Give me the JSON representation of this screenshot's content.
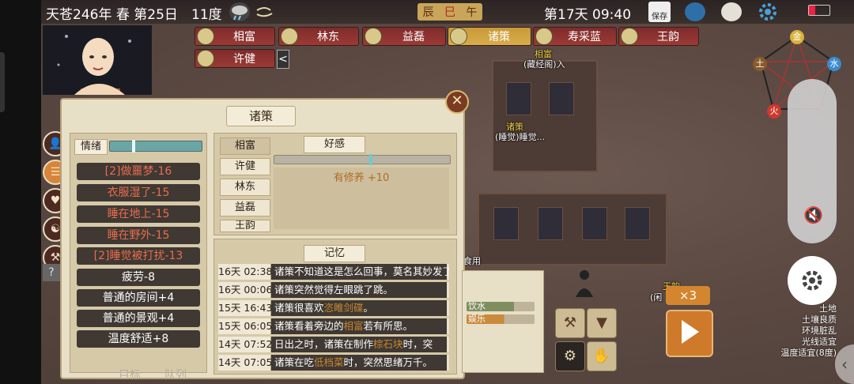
{
  "topbar": {
    "date": "天苍246年 春 第25日",
    "temperature": "11度",
    "shichen": [
      "辰",
      "巳",
      "午"
    ],
    "clock": "第17天 09:40",
    "save_label": "保存"
  },
  "character_tabs": {
    "row1": [
      {
        "name": "相富",
        "selected": false
      },
      {
        "name": "林东",
        "selected": false
      },
      {
        "name": "益磊",
        "selected": false
      },
      {
        "name": "诸策",
        "selected": true
      },
      {
        "name": "寿采蓝",
        "selected": false
      },
      {
        "name": "王韵",
        "selected": false
      }
    ],
    "row2": [
      {
        "name": "许健",
        "selected": false
      }
    ],
    "collapse_glyph": "<"
  },
  "panel": {
    "title": "诸策",
    "close_glyph": "✕",
    "mood": {
      "label": "情绪",
      "level": 0.25,
      "items": [
        {
          "text": "[2]做噩梦-16",
          "type": "neg"
        },
        {
          "text": "衣服湿了-15",
          "type": "neg"
        },
        {
          "text": "睡在地上-15",
          "type": "neg"
        },
        {
          "text": "睡在野外-15",
          "type": "neg"
        },
        {
          "text": "[2]睡觉被打扰-13",
          "type": "neg"
        },
        {
          "text": "疲劳-8",
          "type": "pos"
        },
        {
          "text": "普通的房间+4",
          "type": "pos"
        },
        {
          "text": "普通的景观+4",
          "type": "pos"
        },
        {
          "text": "温度舒适+8",
          "type": "pos"
        }
      ]
    },
    "relations": {
      "label": "好感",
      "names": [
        "相富",
        "许健",
        "林东",
        "益磊",
        "王韵"
      ],
      "selected": "相富",
      "level": 0.55,
      "detail_line": "有修养 +10"
    },
    "memory": {
      "label": "记忆",
      "rows": [
        {
          "time": "16天 02:38",
          "parts": [
            {
              "t": "诸策",
              "hl": false,
              "w": true
            },
            {
              "t": "不知道这是怎么回事，莫名其妙发了",
              "hl": false
            }
          ]
        },
        {
          "time": "16天 00:06",
          "parts": [
            {
              "t": "诸策",
              "hl": false,
              "w": true
            },
            {
              "t": "突然觉得左眼跳了跳。",
              "hl": false
            }
          ]
        },
        {
          "time": "15天 16:43",
          "parts": [
            {
              "t": "诸策",
              "hl": false,
              "w": true
            },
            {
              "t": "很喜欢",
              "hl": false
            },
            {
              "t": "恣睢剑碟",
              "hl": true
            },
            {
              "t": "。",
              "hl": false
            }
          ]
        },
        {
          "time": "15天 06:05",
          "parts": [
            {
              "t": "诸策",
              "hl": false,
              "w": true
            },
            {
              "t": "看着旁边的",
              "hl": false
            },
            {
              "t": "相富",
              "hl": true
            },
            {
              "t": "若有所思。",
              "hl": false
            }
          ]
        },
        {
          "time": "14天 07:52",
          "parts": [
            {
              "t": "日出之时，",
              "hl": false
            },
            {
              "t": "诸策",
              "hl": false,
              "w": true
            },
            {
              "t": "在制作",
              "hl": false
            },
            {
              "t": "棕石块",
              "hl": true
            },
            {
              "t": "时，突",
              "hl": false
            }
          ]
        },
        {
          "time": "14天 07:05",
          "parts": [
            {
              "t": "诸策",
              "hl": false,
              "w": true
            },
            {
              "t": "在吃",
              "hl": false
            },
            {
              "t": "低档菜",
              "hl": true
            },
            {
              "t": "时，突然思绪万千。",
              "hl": false
            }
          ]
        }
      ]
    },
    "bottom_tabs": [
      "目标",
      "队列"
    ]
  },
  "map": {
    "labels": [
      {
        "text": "相富",
        "color": "yellow"
      },
      {
        "text": "(藏经阁)入",
        "color": "white"
      },
      {
        "text": "诸策",
        "color": "yellow"
      },
      {
        "text": "(睡觉)睡觉...",
        "color": "white"
      },
      {
        "text": "食用",
        "color": "white"
      },
      {
        "text": "王韵",
        "color": "yellow"
      },
      {
        "text": "(闲",
        "color": "white"
      }
    ]
  },
  "needs_panel": {
    "items": [
      {
        "label": "饮水",
        "level": 0.7,
        "color": "#7f8e5f"
      },
      {
        "label": "娱乐",
        "level": 0.55,
        "color": "#c98a3c"
      }
    ]
  },
  "speed": {
    "label": "×3"
  },
  "elements": [
    "金",
    "水",
    "火",
    "土"
  ],
  "tile_info": [
    "土地",
    "土壤良质",
    "环境脏乱",
    "光线适宜",
    "温度适宜(8度)"
  ],
  "colors": {
    "accent": "#d8853a",
    "negative": "#e86d4e",
    "highlight": "#c9872e",
    "tab_red": "#9c3a35",
    "tab_gold": "#d9ad4a"
  }
}
